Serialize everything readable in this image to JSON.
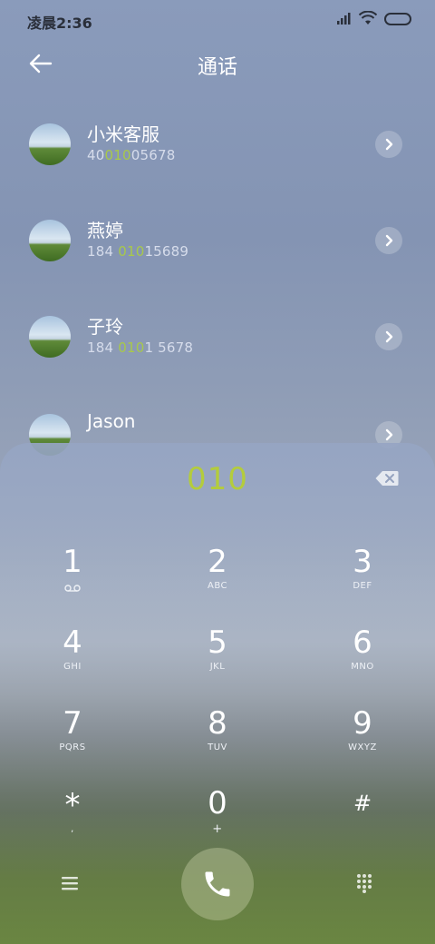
{
  "status_bar": {
    "time": "凌晨2:36"
  },
  "header": {
    "title": "通话"
  },
  "contacts": [
    {
      "name": "小米客服",
      "num_pre": "40",
      "num_hl": "010",
      "num_post": "05678"
    },
    {
      "name": "燕婷",
      "num_pre": "184 ",
      "num_hl": "010",
      "num_post": "15689"
    },
    {
      "name": "子玲",
      "num_pre": "184 ",
      "num_hl": "010",
      "num_post": "1 5678"
    },
    {
      "name": "Jason",
      "num_pre": "",
      "num_hl": "",
      "num_post": ""
    }
  ],
  "dialpad": {
    "input": "010",
    "keys": [
      {
        "digit": "1",
        "letters": ""
      },
      {
        "digit": "2",
        "letters": "ABC"
      },
      {
        "digit": "3",
        "letters": "DEF"
      },
      {
        "digit": "4",
        "letters": "GHI"
      },
      {
        "digit": "5",
        "letters": "JKL"
      },
      {
        "digit": "6",
        "letters": "MNO"
      },
      {
        "digit": "7",
        "letters": "PQRS"
      },
      {
        "digit": "8",
        "letters": "TUV"
      },
      {
        "digit": "9",
        "letters": "WXYZ"
      },
      {
        "digit": "*",
        "letters": ","
      },
      {
        "digit": "0",
        "letters": "+"
      },
      {
        "digit": "#",
        "letters": ""
      }
    ]
  },
  "colors": {
    "highlight": "#a8c94a",
    "input_text": "#b4cc3c"
  }
}
